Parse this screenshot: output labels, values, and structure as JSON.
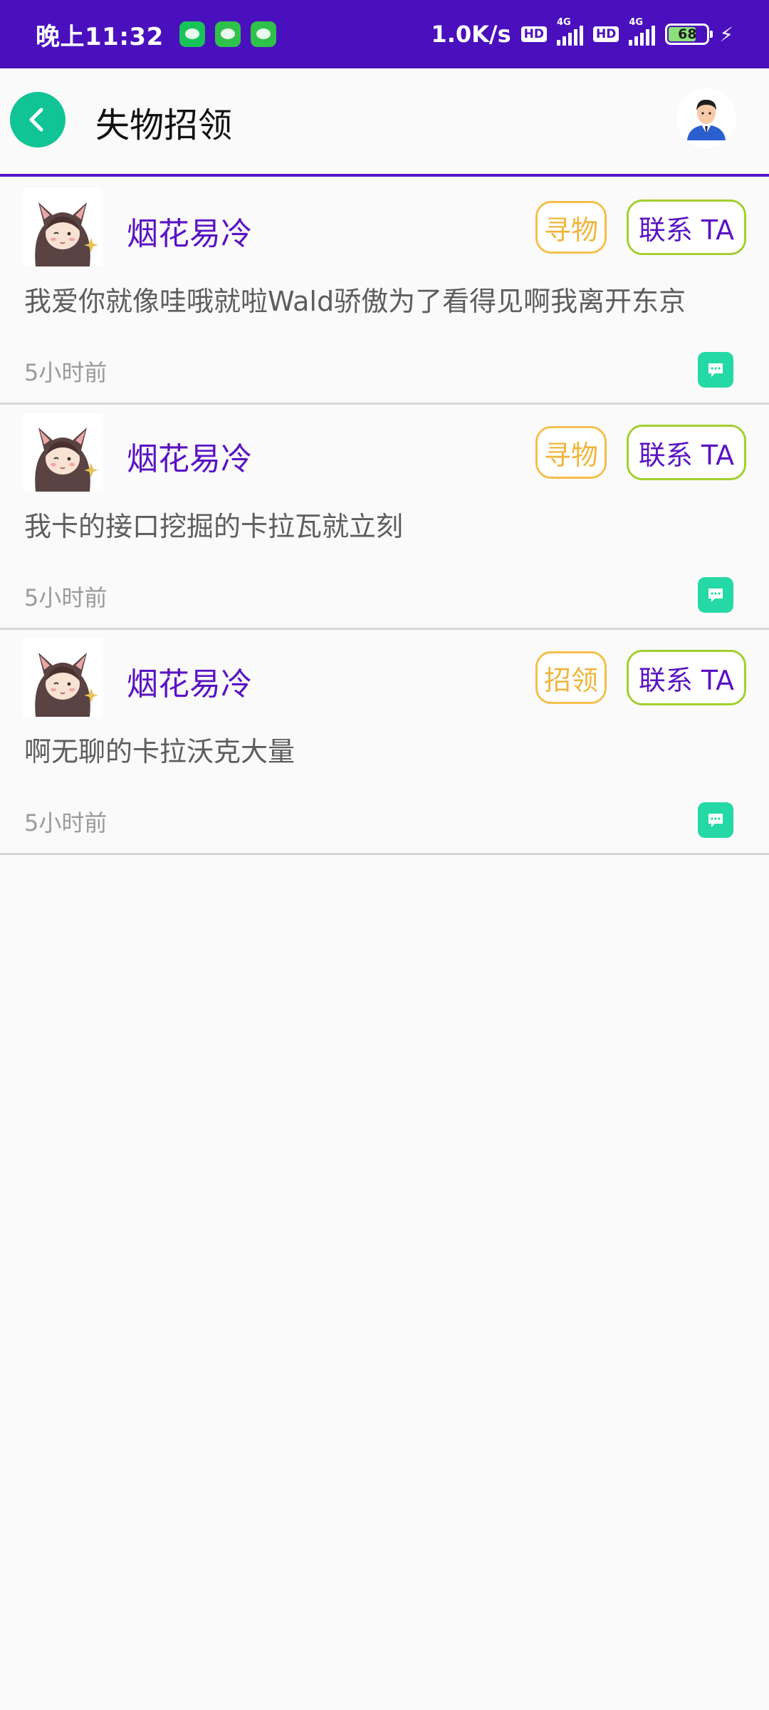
{
  "status_bar": {
    "time": "晚上11:32",
    "net_speed": "1.0K/s",
    "hd_label": "HD",
    "net_type": "4G",
    "battery": "68",
    "apps": [
      "wechat-icon",
      "app-icon",
      "app-icon"
    ]
  },
  "header": {
    "title": "失物招领",
    "back_icon": "chevron-left-icon",
    "profile_icon": "user-avatar-icon"
  },
  "colors": {
    "status_bar_bg": "#4a10bd",
    "accent_purple": "#5a14c2",
    "back_button": "#10c495",
    "tag_border": "#f3c04d",
    "contact_border": "#a3cf2e",
    "message_button": "#25d9a6"
  },
  "posts": [
    {
      "username": "烟花易冷",
      "tag": "寻物",
      "contact_label": "联系 TA",
      "content": "我爱你就像哇哦就啦Wald骄傲为了看得见啊我离开东京",
      "time": "5小时前"
    },
    {
      "username": "烟花易冷",
      "tag": "寻物",
      "contact_label": "联系 TA",
      "content": "我卡的接口挖掘的卡拉瓦就立刻",
      "time": "5小时前"
    },
    {
      "username": "烟花易冷",
      "tag": "招领",
      "contact_label": "联系 TA",
      "content": "啊无聊的卡拉沃克大量",
      "time": "5小时前"
    }
  ]
}
